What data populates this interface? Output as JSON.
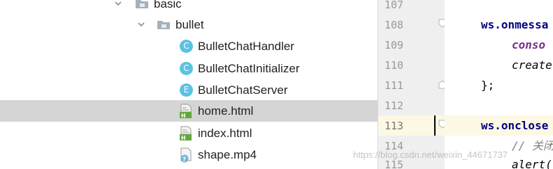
{
  "tree": {
    "items": [
      {
        "label": "basic",
        "kind": "folder"
      },
      {
        "label": "bullet",
        "kind": "folder"
      },
      {
        "label": "BulletChatHandler",
        "kind": "class",
        "badge": "C"
      },
      {
        "label": "BulletChatInitializer",
        "kind": "class",
        "badge": "C"
      },
      {
        "label": "BulletChatServer",
        "kind": "enum",
        "badge": "E"
      },
      {
        "label": "home.html",
        "kind": "html-file",
        "selected": true
      },
      {
        "label": "index.html",
        "kind": "html-file"
      },
      {
        "label": "shape.mp4",
        "kind": "unknown-file"
      }
    ]
  },
  "editor": {
    "lines": [
      {
        "num": "107",
        "code": ""
      },
      {
        "num": "108",
        "code": "ws.onmessa"
      },
      {
        "num": "109",
        "code": "conso"
      },
      {
        "num": "110",
        "code": "create"
      },
      {
        "num": "111",
        "code": "};"
      },
      {
        "num": "112",
        "code": ""
      },
      {
        "num": "113",
        "code": "ws.onclose"
      },
      {
        "num": "114",
        "code": "// 关闭"
      },
      {
        "num": "115",
        "code": "alert("
      }
    ],
    "current_line": "113"
  },
  "watermark": "https://blog.csdn.net/weixin_44671737",
  "colors": {
    "selection": "#d5d5d5",
    "current_line": "#fcf8e3",
    "gutter": "#efefef",
    "class_badge": "#5bc2e2",
    "keyword": "#000080",
    "field": "#7a2e8e"
  }
}
